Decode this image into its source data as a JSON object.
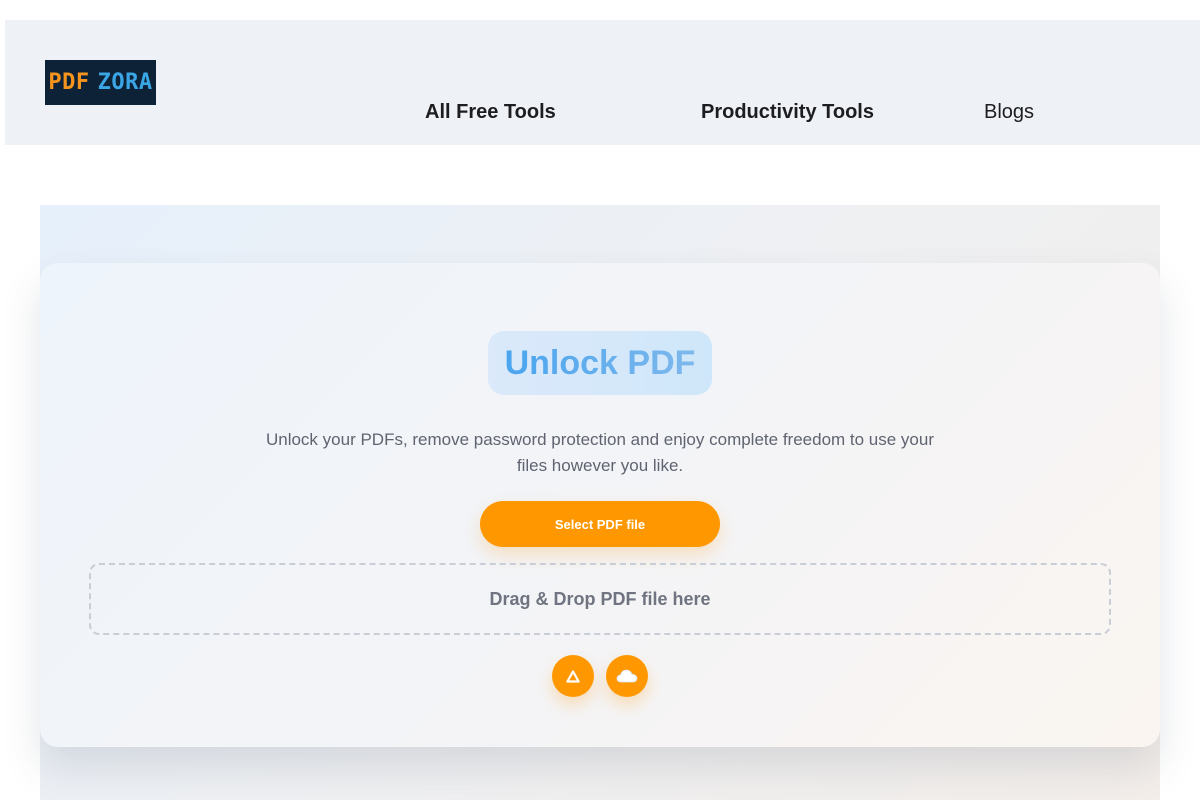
{
  "header": {
    "logo": {
      "part1": "PDF",
      "part2": "ZORA",
      "colors": {
        "part1": "#f7941d",
        "part2": "#3aa6e6",
        "background": "#0d2236"
      }
    },
    "nav": [
      {
        "label": "All Free Tools"
      },
      {
        "label": "Productivity Tools"
      },
      {
        "label": "Blogs"
      }
    ]
  },
  "main": {
    "title": "Unlock PDF",
    "subtitle": "Unlock your PDFs, remove password protection and enjoy complete freedom to use your files however you like.",
    "select_button_label": "Select PDF file",
    "dropzone_text": "Drag & Drop PDF file here",
    "upload_sources": [
      {
        "icon": "google-drive-icon"
      },
      {
        "icon": "cloud-icon"
      }
    ]
  },
  "colors": {
    "accent": "#ff9800",
    "title_gradient_start": "#4aa5ee",
    "header_background": "#eef1f6",
    "text_muted": "#5f6470"
  }
}
